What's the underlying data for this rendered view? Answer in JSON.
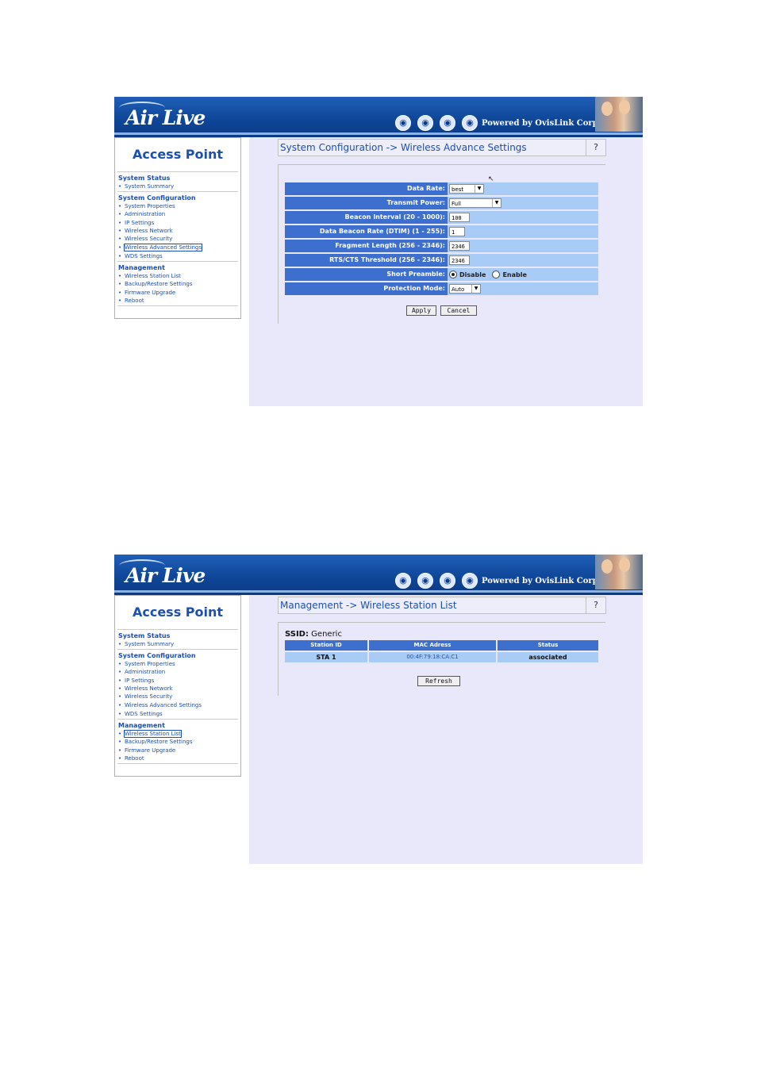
{
  "header": {
    "logo": "Air Live",
    "powered_by": "Powered by OvisLink Corp."
  },
  "sidebar": {
    "title": "Access Point",
    "sections": [
      {
        "title": "System Status",
        "items": [
          "System Summary"
        ]
      },
      {
        "title": "System Configuration",
        "items": [
          "System Properties",
          "Administration",
          "IP Settings",
          "Wireless Network",
          "Wireless Security",
          "Wireless Advanced Settings",
          "WDS Settings"
        ]
      },
      {
        "title": "Management",
        "items": [
          "Wireless Station List",
          "Backup/Restore Settings",
          "Firmware Upgrade",
          "Reboot"
        ]
      }
    ]
  },
  "screen1": {
    "title": "System Configuration -> Wireless Advance Settings",
    "help": "?",
    "selected_nav": "Wireless Advanced Settings",
    "fields": {
      "data_rate": {
        "label": "Data Rate:",
        "value": "best"
      },
      "transmit_power": {
        "label": "Transmit Power:",
        "value": "Full"
      },
      "beacon_interval": {
        "label": "Beacon Interval (20 - 1000):",
        "value": "100"
      },
      "dtim": {
        "label": "Data Beacon Rate (DTIM) (1 - 255):",
        "value": "1"
      },
      "fragment": {
        "label": "Fragment Length (256 - 2346):",
        "value": "2346"
      },
      "rts": {
        "label": "RTS/CTS Threshold (256 - 2346):",
        "value": "2346"
      },
      "preamble": {
        "label": "Short Preamble:",
        "opt_disable": "Disable",
        "opt_enable": "Enable",
        "selected": "Disable"
      },
      "protection": {
        "label": "Protection Mode:",
        "value": "Auto"
      }
    },
    "apply": "Apply",
    "cancel": "Cancel"
  },
  "screen2": {
    "title": "Management -> Wireless Station List",
    "help": "?",
    "selected_nav": "Wireless Station List",
    "ssid_label": "SSID:",
    "ssid_value": "Generic",
    "columns": [
      "Station ID",
      "MAC Adress",
      "Status"
    ],
    "rows": [
      [
        "STA 1",
        "00:4F:79:18:CA:C1",
        "associated"
      ]
    ],
    "refresh": "Refresh"
  }
}
